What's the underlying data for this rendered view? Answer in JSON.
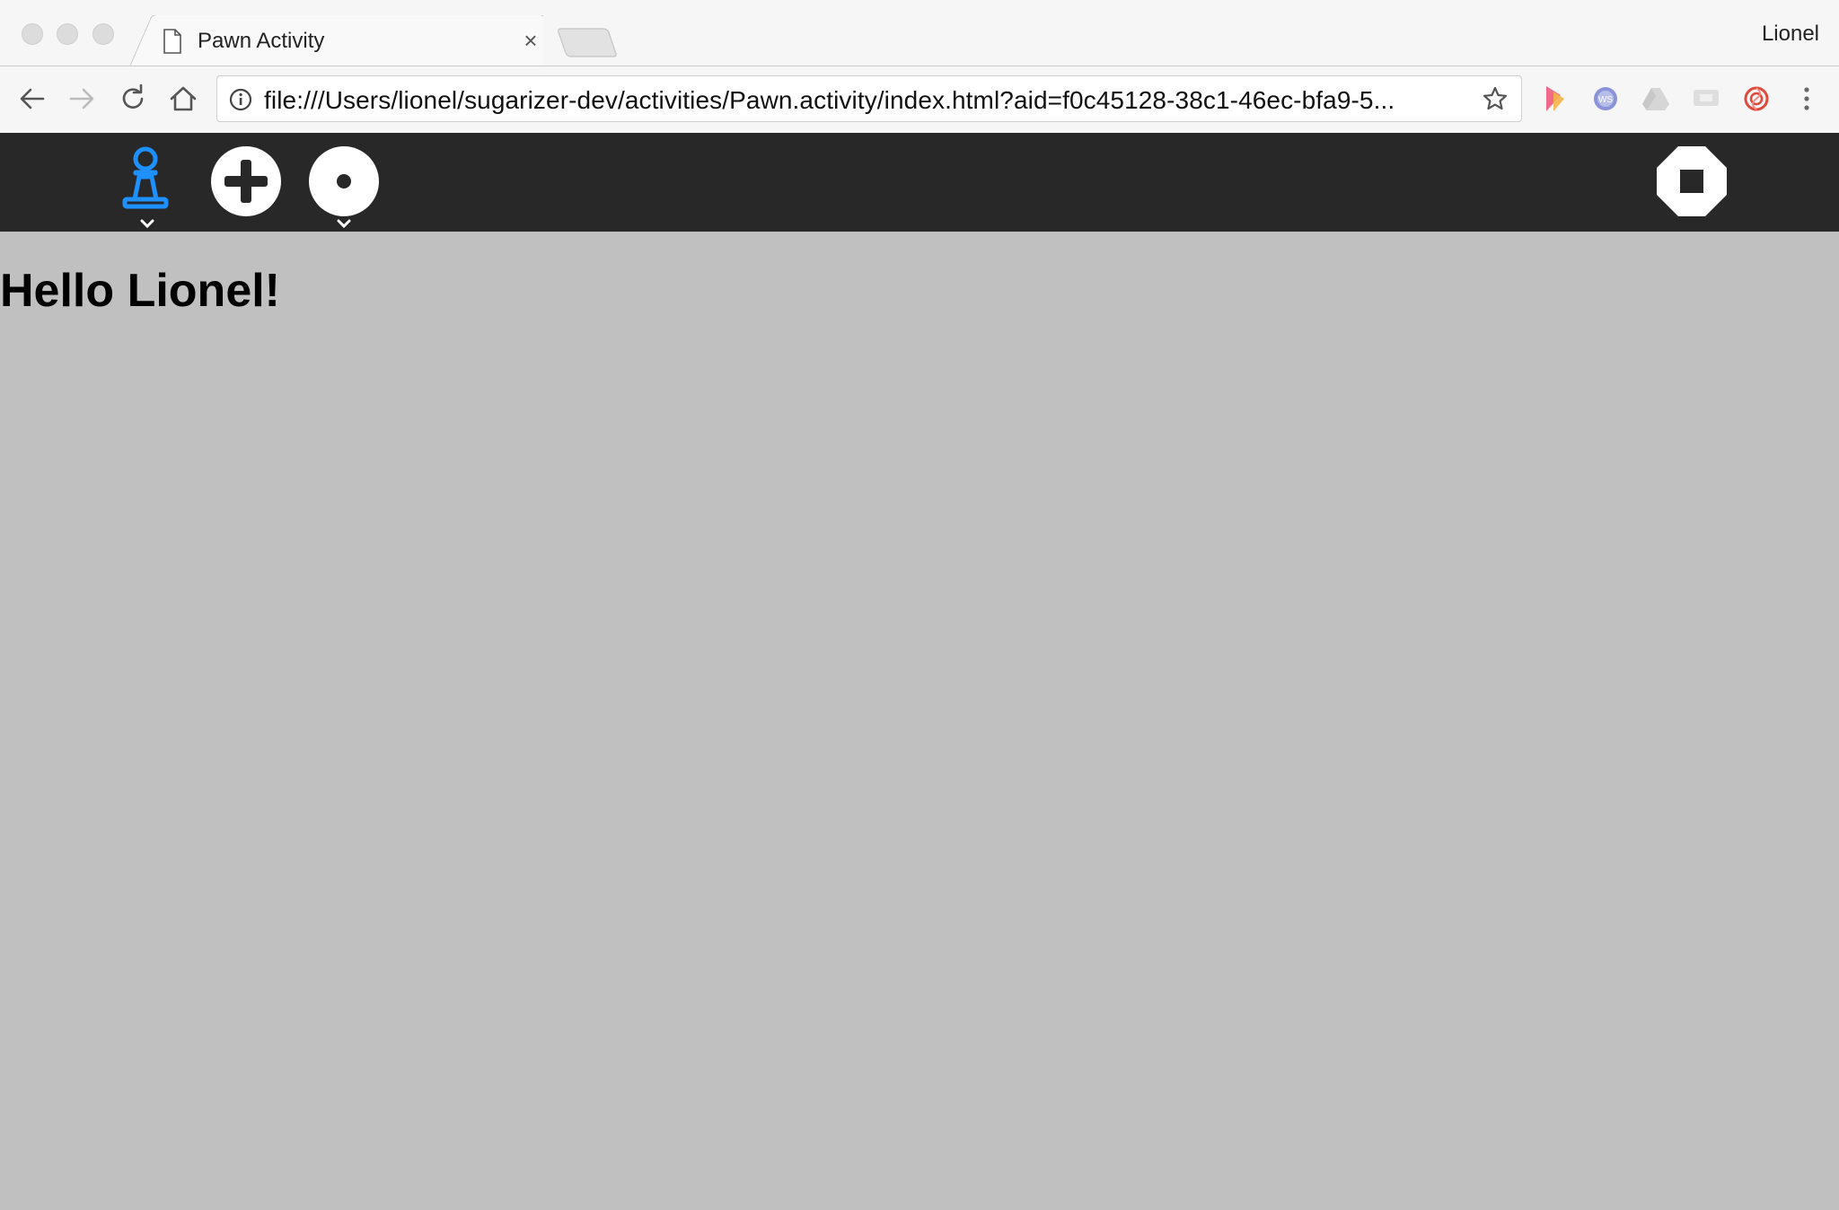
{
  "browser": {
    "tab": {
      "title": "Pawn Activity"
    },
    "profile_name": "Lionel",
    "address_bar": {
      "url": "file:///Users/lionel/sugarizer-dev/activities/Pawn.activity/index.html?aid=f0c45128-38c1-46ec-bfa9-5..."
    },
    "extensions": [
      "pdf-extension-icon",
      "ws-extension-icon",
      "drive-extension-icon",
      "chat-extension-icon",
      "spiral-extension-icon"
    ]
  },
  "activity_toolbar": {
    "colors": {
      "background": "#282828",
      "pawn_accent": "#1e90ff",
      "button_fill": "#ffffff"
    }
  },
  "content": {
    "greeting": "Hello Lionel!",
    "background": "#c0c0c0"
  }
}
